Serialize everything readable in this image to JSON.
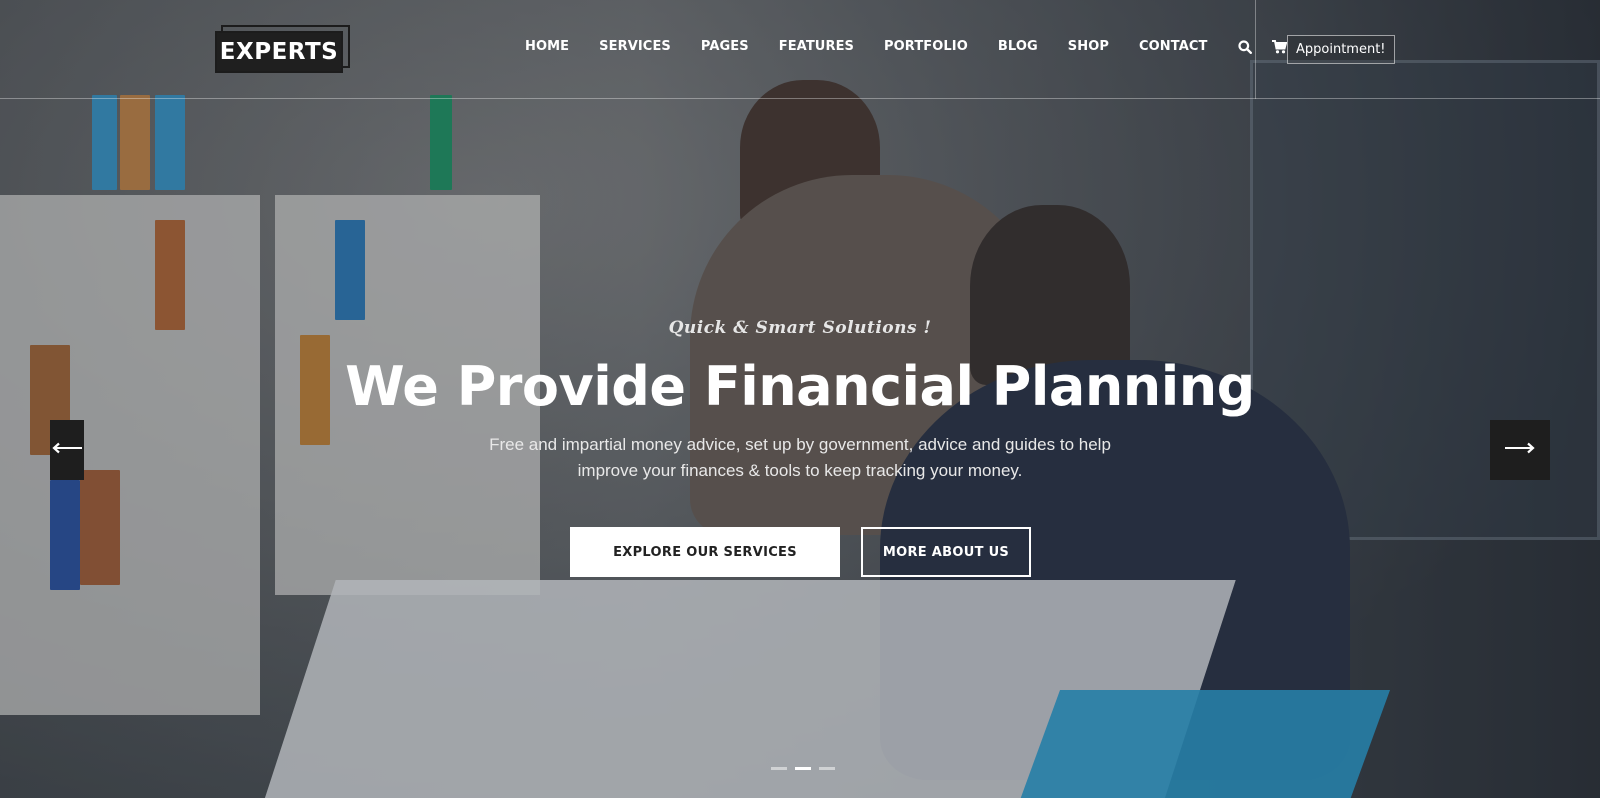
{
  "brand": {
    "logo_text": "EXPERTS"
  },
  "nav": {
    "items": [
      {
        "label": "HOME"
      },
      {
        "label": "SERVICES"
      },
      {
        "label": "PAGES"
      },
      {
        "label": "FEATURES"
      },
      {
        "label": "PORTFOLIO"
      },
      {
        "label": "BLOG"
      },
      {
        "label": "SHOP"
      },
      {
        "label": "CONTACT"
      }
    ],
    "icons": [
      "search-icon",
      "cart-icon"
    ],
    "appointment_label": "Appointment!"
  },
  "hero": {
    "tagline": "Quick & Smart Solutions !",
    "headline": "We Provide Financial Planning",
    "description_line1": "Free and impartial money advice, set up by government, advice and guides to help",
    "description_line2": "improve your finances & tools to keep tracking your money.",
    "primary_button": "EXPLORE OUR SERVICES",
    "secondary_button": "MORE ABOUT US"
  },
  "slider": {
    "prev_icon": "arrow-left-icon",
    "next_icon": "arrow-right-icon",
    "slide_count": 3,
    "active_slide": 2
  }
}
